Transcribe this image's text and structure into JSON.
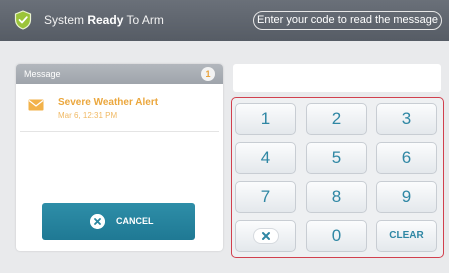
{
  "topbar": {
    "status_prefix": "System ",
    "status_bold": "Ready",
    "status_suffix": " To Arm",
    "code_prompt": "Enter your code to read the message",
    "icon": "shield-check-icon"
  },
  "messages": {
    "header": "Message",
    "count": "1",
    "items": [
      {
        "title": "Severe Weather Alert",
        "time": "Mar 6, 12:31 PM",
        "icon": "envelope-icon"
      }
    ],
    "cancel_label": "CANCEL"
  },
  "keypad": {
    "keys": [
      "1",
      "2",
      "3",
      "4",
      "5",
      "6",
      "7",
      "8",
      "9"
    ],
    "zero": "0",
    "clear": "CLEAR",
    "backspace_icon": "backspace-x-icon"
  },
  "colors": {
    "accent": "#2f87a4",
    "alert": "#eba73d",
    "keypad_border": "#d1404e",
    "topbar": "#5f656e"
  }
}
